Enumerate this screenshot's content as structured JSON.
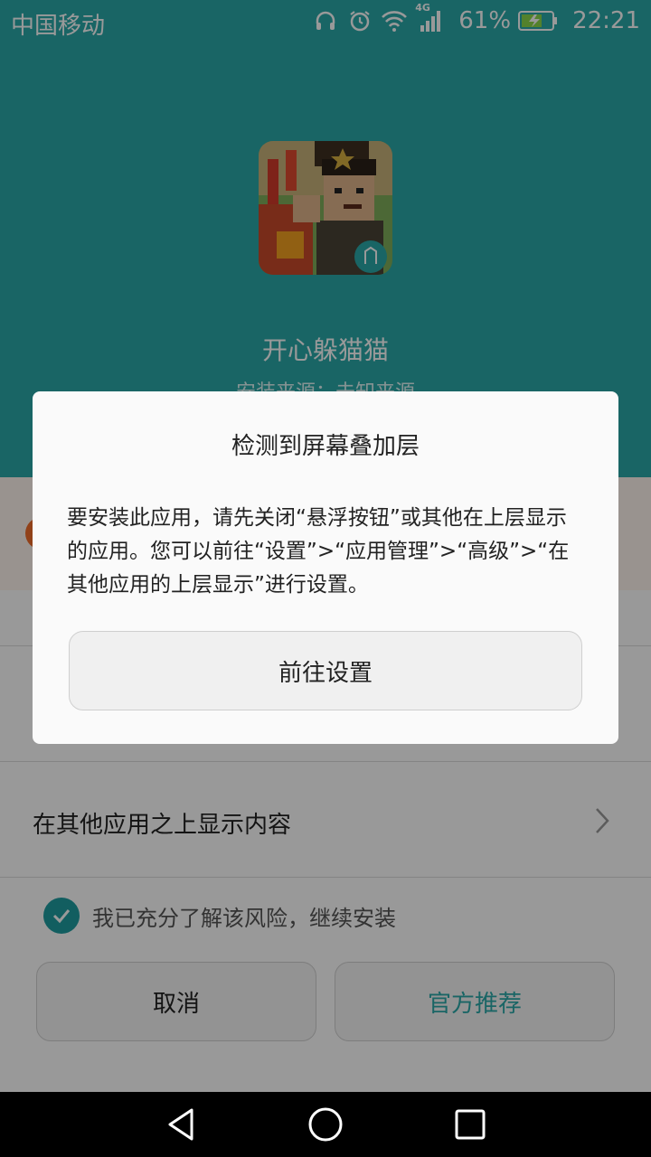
{
  "status_bar": {
    "carrier": "中国移动",
    "network": "4G",
    "battery_percent": "61%",
    "time": "22:21",
    "icons": [
      "headphones-icon",
      "alarm-icon",
      "wifi-icon",
      "signal-icon",
      "battery-charging-icon"
    ]
  },
  "app": {
    "name": "开心躲猫猫",
    "source": "安装来源：未知来源"
  },
  "settings": {
    "overlay_item_label": "在其他应用之上显示内容",
    "agree_label": "我已充分了解该风险，继续安装",
    "agree_checked": true
  },
  "buttons": {
    "cancel": "取消",
    "recommend": "官方推荐"
  },
  "dialog": {
    "title": "检测到屏幕叠加层",
    "message": "要安装此应用，请先关闭“悬浮按钮”或其他在上层显示的应用。您可以前往“设置”>“应用管理”>“高级”>“在其他应用的上层显示”进行设置。",
    "button": "前往设置"
  },
  "nav": {
    "icons": [
      "back-icon",
      "home-icon",
      "recents-icon"
    ]
  },
  "colors": {
    "teal": "#2aa8a8",
    "check": "#1f9da1",
    "warning": "#f26d2a"
  }
}
